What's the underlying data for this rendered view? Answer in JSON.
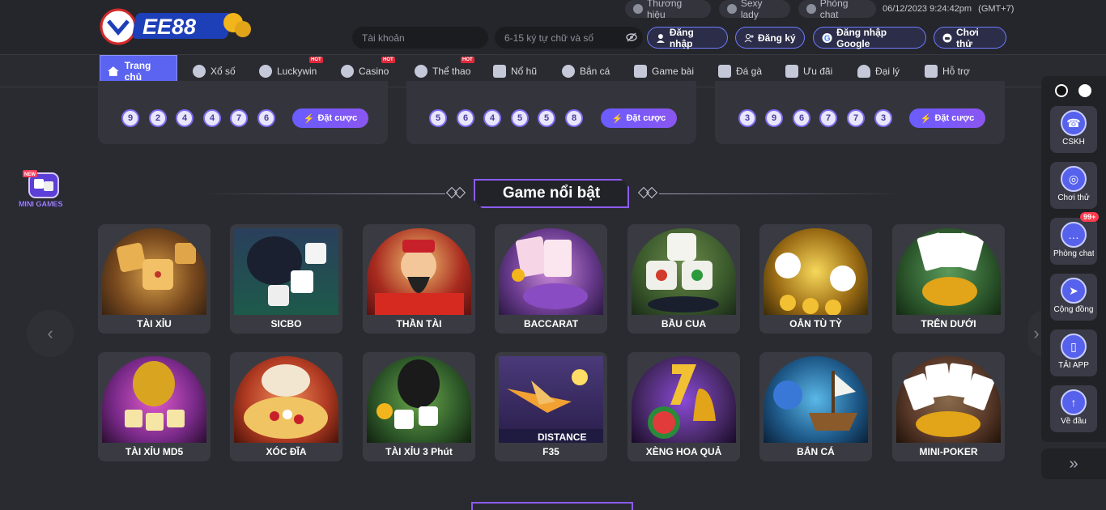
{
  "brand": {
    "logo_text": "EE88"
  },
  "header": {
    "util_links": [
      "Thương hiệu",
      "Sexy lady",
      "Phòng chat"
    ],
    "datetime": "06/12/2023 9:24:42pm",
    "timezone": "(GMT+7)",
    "username_placeholder": "Tài khoản",
    "password_placeholder": "6-15 ký tự chữ và số",
    "login_label": "Đăng nhập",
    "register_label": "Đăng ký",
    "google_label": "Đăng nhập Google",
    "try_label": "Chơi thử"
  },
  "nav": {
    "items": [
      {
        "label": "Trang chủ",
        "active": true,
        "hot": false
      },
      {
        "label": "Xổ số",
        "hot": false
      },
      {
        "label": "Luckywin",
        "hot": true
      },
      {
        "label": "Casino",
        "hot": true
      },
      {
        "label": "Thể thao",
        "hot": true
      },
      {
        "label": "Nổ hũ",
        "hot": false
      },
      {
        "label": "Bắn cá",
        "hot": false
      },
      {
        "label": "Game bài",
        "hot": false
      },
      {
        "label": "Đá gà",
        "hot": false
      },
      {
        "label": "Ưu đãi",
        "hot": false
      },
      {
        "label": "Đại lý",
        "hot": false
      },
      {
        "label": "Hỗ trợ",
        "hot": false
      }
    ],
    "hot_label": "HOT"
  },
  "lotto": {
    "bet_label": "Đặt cược",
    "cards": [
      {
        "balls": [
          "9",
          "2",
          "4",
          "4",
          "7",
          "6"
        ]
      },
      {
        "balls": [
          "5",
          "6",
          "4",
          "5",
          "5",
          "8"
        ]
      },
      {
        "balls": [
          "3",
          "9",
          "6",
          "7",
          "7",
          "3"
        ]
      }
    ]
  },
  "featured": {
    "title": "Game nổi bật",
    "games": [
      {
        "name": "TÀI XỈU",
        "color": "#7a4a1e"
      },
      {
        "name": "SICBO",
        "color": "#2e3f55"
      },
      {
        "name": "THẦN TÀI",
        "color": "#a82a1f"
      },
      {
        "name": "BACCARAT",
        "color": "#6a3b8f"
      },
      {
        "name": "BẦU CUA",
        "color": "#3b5a2c"
      },
      {
        "name": "OẲN TÙ TỲ",
        "color": "#9a6b14"
      },
      {
        "name": "TRÊN DƯỚI",
        "color": "#2e5a2e"
      },
      {
        "name": "TÀI XỈU MD5",
        "color": "#7a2a8a"
      },
      {
        "name": "XÓC ĐĨA",
        "color": "#b03a22"
      },
      {
        "name": "TÀI XỈU 3 Phút",
        "color": "#2f5a2a"
      },
      {
        "name": "F35",
        "color": "#3b2a5a"
      },
      {
        "name": "XÈNG HOA QUẢ",
        "color": "#4a2a6a"
      },
      {
        "name": "BẮN CÁ",
        "color": "#1e5a8a"
      },
      {
        "name": "MINI-POKER",
        "color": "#5a3a2a"
      }
    ],
    "overlay_text": "DISTANCE"
  },
  "rail": {
    "items": [
      "CSKH",
      "Chơi thử",
      "Phòng chat",
      "Cộng đồng",
      "TẢI APP",
      "Về đầu"
    ],
    "badge": "99+"
  },
  "mini_games": {
    "new_label": "NEW",
    "label": "MINI GAMES"
  }
}
